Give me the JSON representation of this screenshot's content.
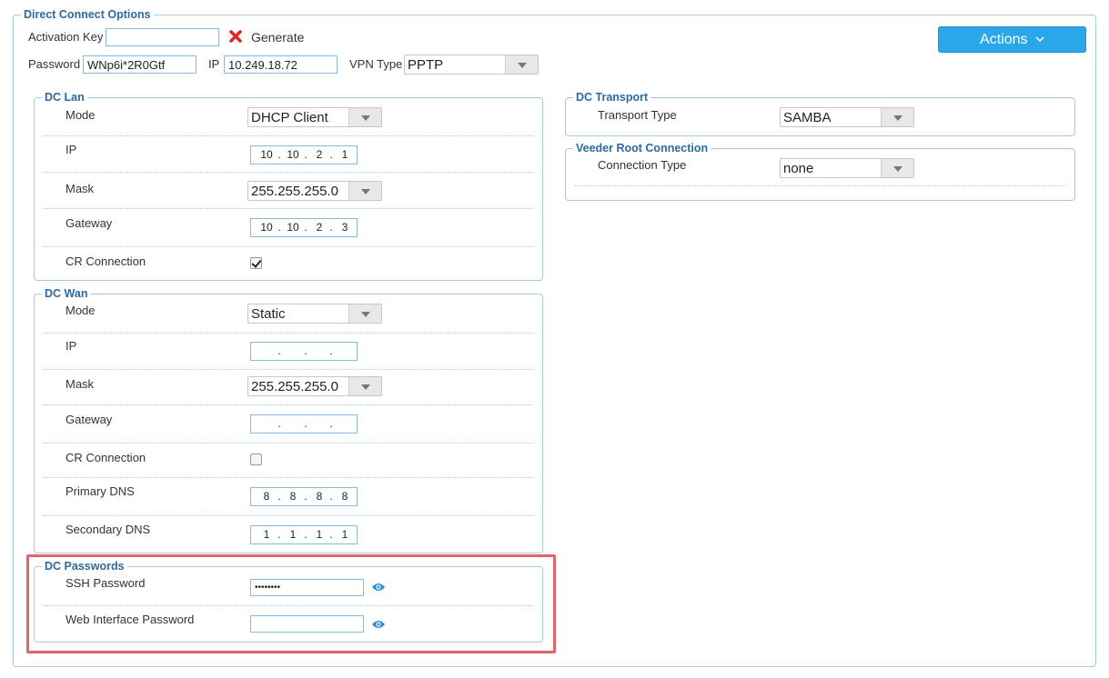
{
  "main": {
    "title": "Direct Connect Options",
    "activation_key_label": "Activation Key",
    "activation_key_value": "",
    "generate_label": "Generate",
    "password_label": "Password",
    "password_value": "WNp6i*2R0Gtf",
    "ip_label": "IP",
    "ip_value": "10.249.18.72",
    "vpn_type_label": "VPN Type",
    "vpn_type_value": "PPTP",
    "actions_label": "Actions"
  },
  "dc_lan": {
    "title": "DC Lan",
    "mode_label": "Mode",
    "mode_value": "DHCP Client",
    "ip_label": "IP",
    "ip": [
      "10",
      "10",
      "2",
      "1"
    ],
    "mask_label": "Mask",
    "mask_value": "255.255.255.0",
    "gateway_label": "Gateway",
    "gateway": [
      "10",
      "10",
      "2",
      "3"
    ],
    "cr_label": "CR Connection",
    "cr_checked": true
  },
  "dc_wan": {
    "title": "DC Wan",
    "mode_label": "Mode",
    "mode_value": "Static",
    "ip_label": "IP",
    "ip": [
      "",
      "",
      "",
      ""
    ],
    "mask_label": "Mask",
    "mask_value": "255.255.255.0",
    "gateway_label": "Gateway",
    "gateway": [
      "",
      "",
      "",
      ""
    ],
    "cr_label": "CR Connection",
    "cr_checked": false,
    "primary_dns_label": "Primary DNS",
    "primary_dns": [
      "8",
      "8",
      "8",
      "8"
    ],
    "secondary_dns_label": "Secondary DNS",
    "secondary_dns": [
      "1",
      "1",
      "1",
      "1"
    ]
  },
  "dc_passwords": {
    "title": "DC Passwords",
    "ssh_label": "SSH Password",
    "ssh_value": "••••••••",
    "web_label": "Web Interface Password",
    "web_value": ""
  },
  "dc_transport": {
    "title": "DC Transport",
    "type_label": "Transport Type",
    "type_value": "SAMBA"
  },
  "veeder_root": {
    "title": "Veeder Root Connection",
    "type_label": "Connection Type",
    "type_value": "none"
  },
  "colors": {
    "accent": "#29a7e8",
    "legend": "#2e6a9e",
    "highlight": "#e06468",
    "error_x": "#e0262b"
  }
}
